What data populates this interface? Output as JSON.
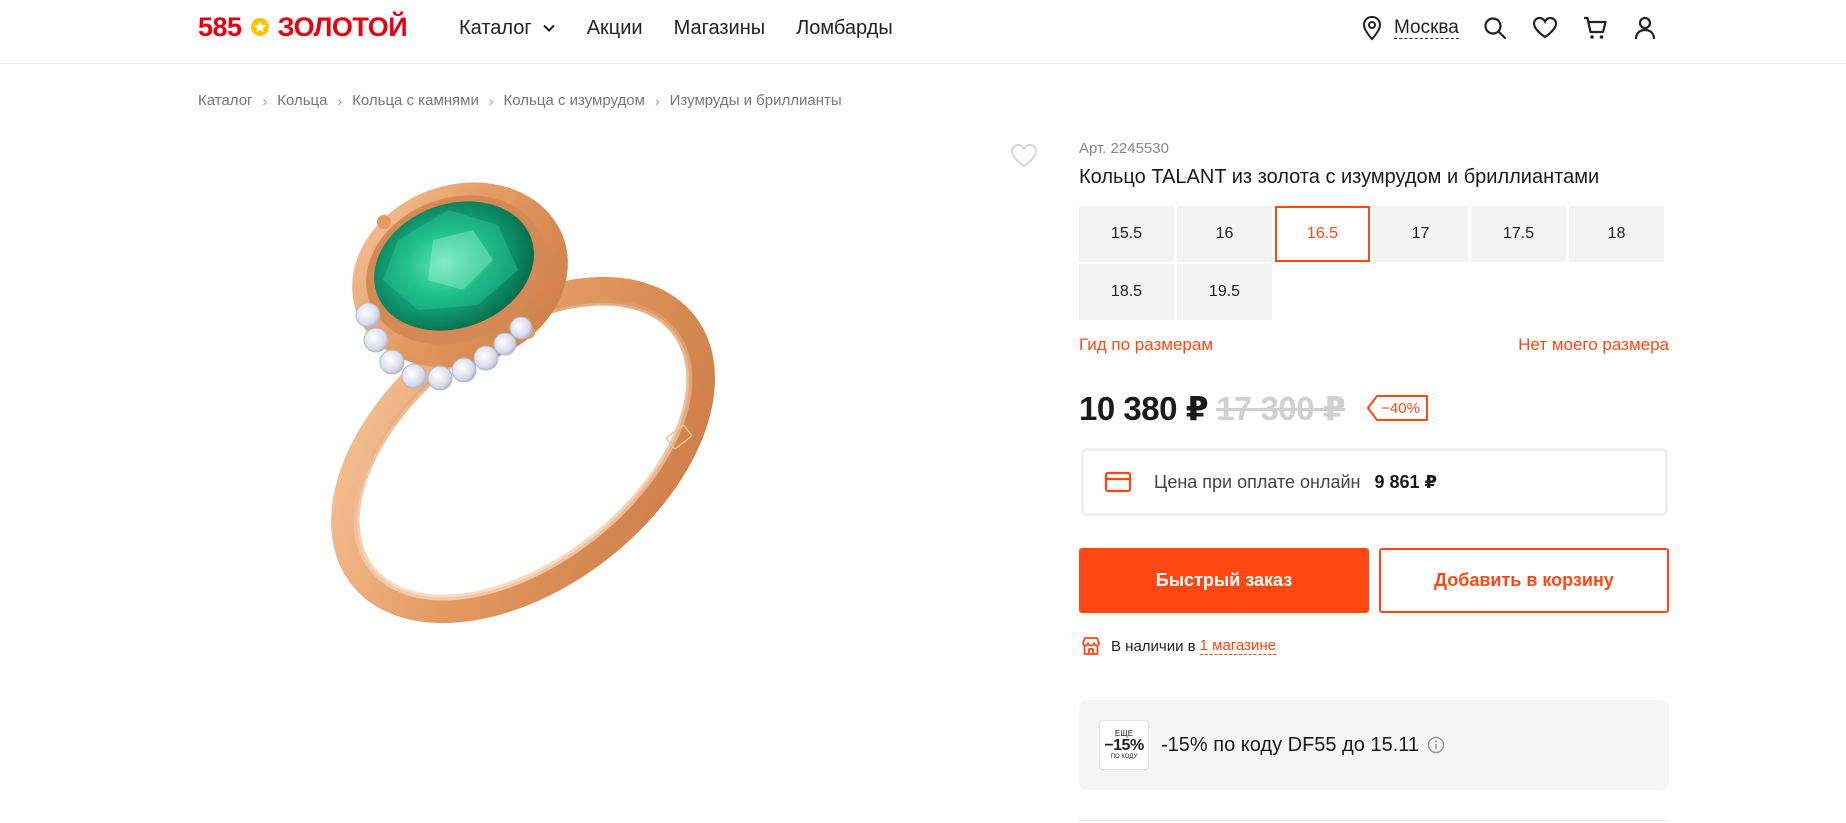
{
  "header": {
    "logo_number": "585",
    "logo_word": "ЗОЛОТОЙ",
    "nav": [
      {
        "label": "Каталог",
        "has_dropdown": true
      },
      {
        "label": "Акции"
      },
      {
        "label": "Магазины"
      },
      {
        "label": "Ломбарды"
      }
    ],
    "city": "Москва",
    "icons": [
      "location-icon",
      "search-icon",
      "heart-icon",
      "cart-icon",
      "user-icon"
    ]
  },
  "breadcrumb": [
    "Каталог",
    "Кольца",
    "Кольца с камнями",
    "Кольца с изумрудом",
    "Изумруды и бриллианты"
  ],
  "product": {
    "article": "Арт. 2245530",
    "title": "Кольцо TALANT из золота с изумрудом и бриллиантами",
    "sizes": [
      "15.5",
      "16",
      "16.5",
      "17",
      "17.5",
      "18",
      "18.5",
      "19.5"
    ],
    "selected_size": "16.5",
    "size_guide": "Гид по размерам",
    "no_size": "Нет моего размера",
    "price": "10 380 ₽",
    "old_price": "17 300 ₽",
    "discount": "−40%",
    "online_label": "Цена при оплате онлайн",
    "online_price": "9 861 ₽",
    "quick_order": "Быстрый заказ",
    "add_to_cart": "Добавить в корзину",
    "availability_text": "В наличии в",
    "availability_link": "1 магазине",
    "promo_badge_top": "ЕЩЕ",
    "promo_badge_value": "−15%",
    "promo_badge_bottom": "ПО КОДУ",
    "promo_text": "-15% по коду DF55 до 15.11"
  },
  "colors": {
    "brand_red": "#e8000f",
    "accent": "#ff4713",
    "gold": "#e8a06a",
    "emerald": "#0fa878"
  }
}
